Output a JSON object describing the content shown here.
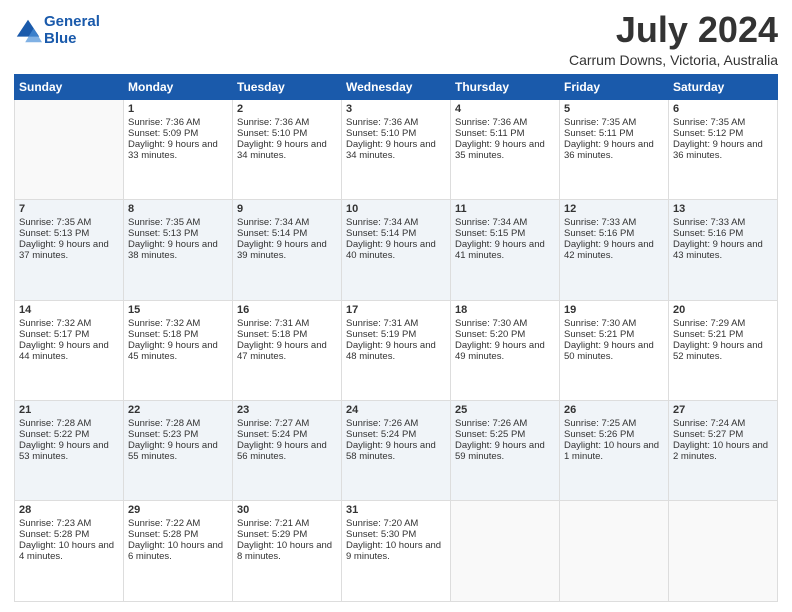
{
  "logo": {
    "line1": "General",
    "line2": "Blue"
  },
  "title": "July 2024",
  "subtitle": "Carrum Downs, Victoria, Australia",
  "days": [
    "Sunday",
    "Monday",
    "Tuesday",
    "Wednesday",
    "Thursday",
    "Friday",
    "Saturday"
  ],
  "weeks": [
    [
      {
        "num": "",
        "sunrise": "",
        "sunset": "",
        "daylight": ""
      },
      {
        "num": "1",
        "sunrise": "Sunrise: 7:36 AM",
        "sunset": "Sunset: 5:09 PM",
        "daylight": "Daylight: 9 hours and 33 minutes."
      },
      {
        "num": "2",
        "sunrise": "Sunrise: 7:36 AM",
        "sunset": "Sunset: 5:10 PM",
        "daylight": "Daylight: 9 hours and 34 minutes."
      },
      {
        "num": "3",
        "sunrise": "Sunrise: 7:36 AM",
        "sunset": "Sunset: 5:10 PM",
        "daylight": "Daylight: 9 hours and 34 minutes."
      },
      {
        "num": "4",
        "sunrise": "Sunrise: 7:36 AM",
        "sunset": "Sunset: 5:11 PM",
        "daylight": "Daylight: 9 hours and 35 minutes."
      },
      {
        "num": "5",
        "sunrise": "Sunrise: 7:35 AM",
        "sunset": "Sunset: 5:11 PM",
        "daylight": "Daylight: 9 hours and 36 minutes."
      },
      {
        "num": "6",
        "sunrise": "Sunrise: 7:35 AM",
        "sunset": "Sunset: 5:12 PM",
        "daylight": "Daylight: 9 hours and 36 minutes."
      }
    ],
    [
      {
        "num": "7",
        "sunrise": "Sunrise: 7:35 AM",
        "sunset": "Sunset: 5:13 PM",
        "daylight": "Daylight: 9 hours and 37 minutes."
      },
      {
        "num": "8",
        "sunrise": "Sunrise: 7:35 AM",
        "sunset": "Sunset: 5:13 PM",
        "daylight": "Daylight: 9 hours and 38 minutes."
      },
      {
        "num": "9",
        "sunrise": "Sunrise: 7:34 AM",
        "sunset": "Sunset: 5:14 PM",
        "daylight": "Daylight: 9 hours and 39 minutes."
      },
      {
        "num": "10",
        "sunrise": "Sunrise: 7:34 AM",
        "sunset": "Sunset: 5:14 PM",
        "daylight": "Daylight: 9 hours and 40 minutes."
      },
      {
        "num": "11",
        "sunrise": "Sunrise: 7:34 AM",
        "sunset": "Sunset: 5:15 PM",
        "daylight": "Daylight: 9 hours and 41 minutes."
      },
      {
        "num": "12",
        "sunrise": "Sunrise: 7:33 AM",
        "sunset": "Sunset: 5:16 PM",
        "daylight": "Daylight: 9 hours and 42 minutes."
      },
      {
        "num": "13",
        "sunrise": "Sunrise: 7:33 AM",
        "sunset": "Sunset: 5:16 PM",
        "daylight": "Daylight: 9 hours and 43 minutes."
      }
    ],
    [
      {
        "num": "14",
        "sunrise": "Sunrise: 7:32 AM",
        "sunset": "Sunset: 5:17 PM",
        "daylight": "Daylight: 9 hours and 44 minutes."
      },
      {
        "num": "15",
        "sunrise": "Sunrise: 7:32 AM",
        "sunset": "Sunset: 5:18 PM",
        "daylight": "Daylight: 9 hours and 45 minutes."
      },
      {
        "num": "16",
        "sunrise": "Sunrise: 7:31 AM",
        "sunset": "Sunset: 5:18 PM",
        "daylight": "Daylight: 9 hours and 47 minutes."
      },
      {
        "num": "17",
        "sunrise": "Sunrise: 7:31 AM",
        "sunset": "Sunset: 5:19 PM",
        "daylight": "Daylight: 9 hours and 48 minutes."
      },
      {
        "num": "18",
        "sunrise": "Sunrise: 7:30 AM",
        "sunset": "Sunset: 5:20 PM",
        "daylight": "Daylight: 9 hours and 49 minutes."
      },
      {
        "num": "19",
        "sunrise": "Sunrise: 7:30 AM",
        "sunset": "Sunset: 5:21 PM",
        "daylight": "Daylight: 9 hours and 50 minutes."
      },
      {
        "num": "20",
        "sunrise": "Sunrise: 7:29 AM",
        "sunset": "Sunset: 5:21 PM",
        "daylight": "Daylight: 9 hours and 52 minutes."
      }
    ],
    [
      {
        "num": "21",
        "sunrise": "Sunrise: 7:28 AM",
        "sunset": "Sunset: 5:22 PM",
        "daylight": "Daylight: 9 hours and 53 minutes."
      },
      {
        "num": "22",
        "sunrise": "Sunrise: 7:28 AM",
        "sunset": "Sunset: 5:23 PM",
        "daylight": "Daylight: 9 hours and 55 minutes."
      },
      {
        "num": "23",
        "sunrise": "Sunrise: 7:27 AM",
        "sunset": "Sunset: 5:24 PM",
        "daylight": "Daylight: 9 hours and 56 minutes."
      },
      {
        "num": "24",
        "sunrise": "Sunrise: 7:26 AM",
        "sunset": "Sunset: 5:24 PM",
        "daylight": "Daylight: 9 hours and 58 minutes."
      },
      {
        "num": "25",
        "sunrise": "Sunrise: 7:26 AM",
        "sunset": "Sunset: 5:25 PM",
        "daylight": "Daylight: 9 hours and 59 minutes."
      },
      {
        "num": "26",
        "sunrise": "Sunrise: 7:25 AM",
        "sunset": "Sunset: 5:26 PM",
        "daylight": "Daylight: 10 hours and 1 minute."
      },
      {
        "num": "27",
        "sunrise": "Sunrise: 7:24 AM",
        "sunset": "Sunset: 5:27 PM",
        "daylight": "Daylight: 10 hours and 2 minutes."
      }
    ],
    [
      {
        "num": "28",
        "sunrise": "Sunrise: 7:23 AM",
        "sunset": "Sunset: 5:28 PM",
        "daylight": "Daylight: 10 hours and 4 minutes."
      },
      {
        "num": "29",
        "sunrise": "Sunrise: 7:22 AM",
        "sunset": "Sunset: 5:28 PM",
        "daylight": "Daylight: 10 hours and 6 minutes."
      },
      {
        "num": "30",
        "sunrise": "Sunrise: 7:21 AM",
        "sunset": "Sunset: 5:29 PM",
        "daylight": "Daylight: 10 hours and 8 minutes."
      },
      {
        "num": "31",
        "sunrise": "Sunrise: 7:20 AM",
        "sunset": "Sunset: 5:30 PM",
        "daylight": "Daylight: 10 hours and 9 minutes."
      },
      {
        "num": "",
        "sunrise": "",
        "sunset": "",
        "daylight": ""
      },
      {
        "num": "",
        "sunrise": "",
        "sunset": "",
        "daylight": ""
      },
      {
        "num": "",
        "sunrise": "",
        "sunset": "",
        "daylight": ""
      }
    ]
  ]
}
